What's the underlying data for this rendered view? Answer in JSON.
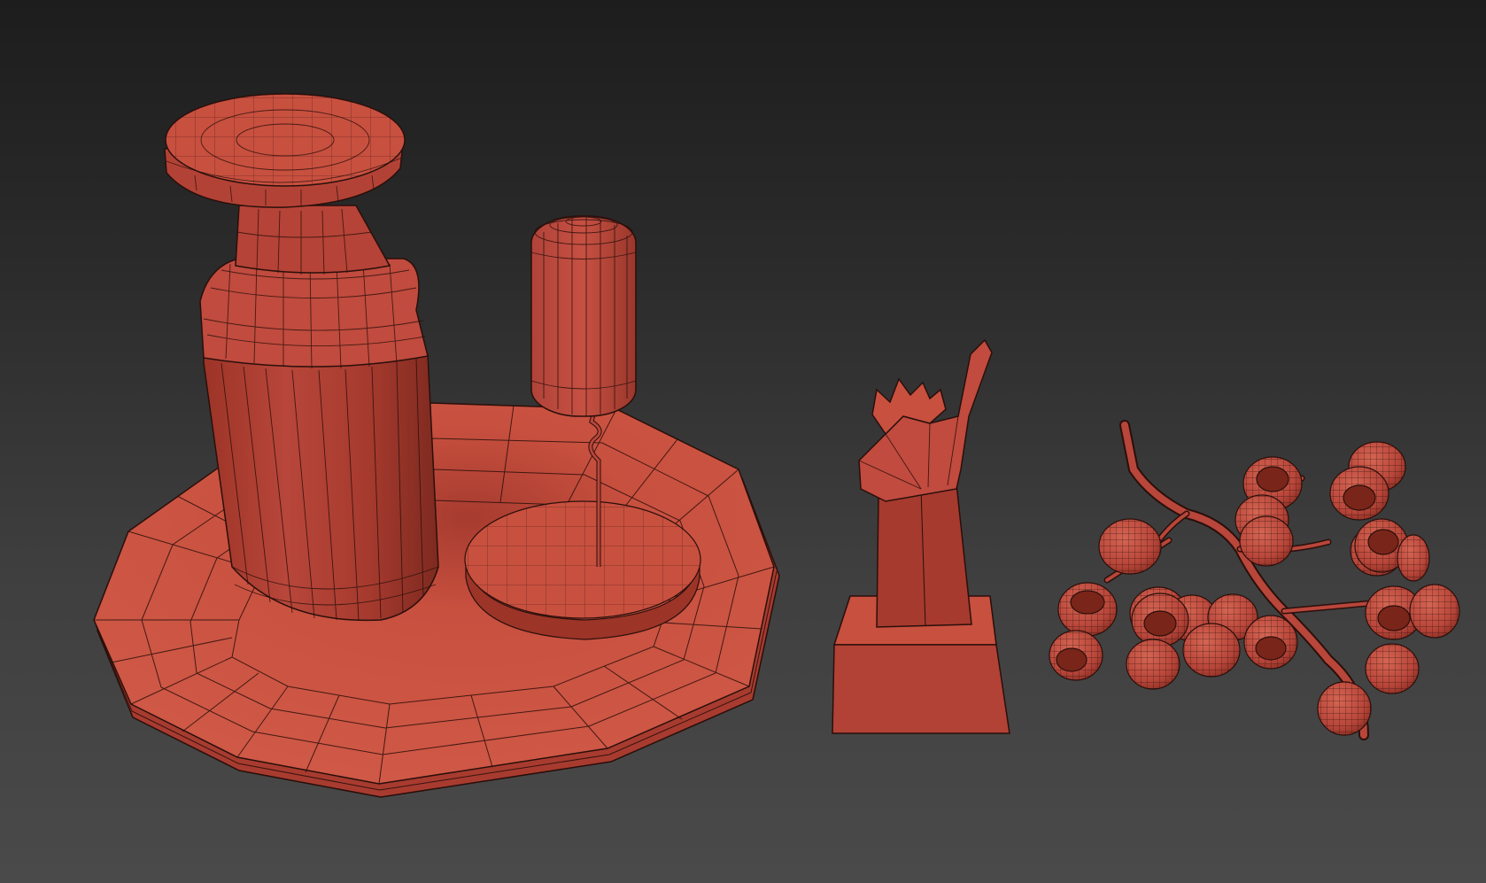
{
  "scene": {
    "objects": [
      "wine-bottle",
      "corkscrew",
      "serving-tray",
      "trophy-hand-statue",
      "grape-cluster"
    ]
  },
  "colors": {
    "background_top": "#1d1d1d",
    "background_bottom": "#4a4a4a",
    "mesh_fill": "#c8503f",
    "mesh_fill_dark": "#9c3427",
    "mesh_fill_light": "#d56553",
    "wire": "#2a0f0b"
  }
}
